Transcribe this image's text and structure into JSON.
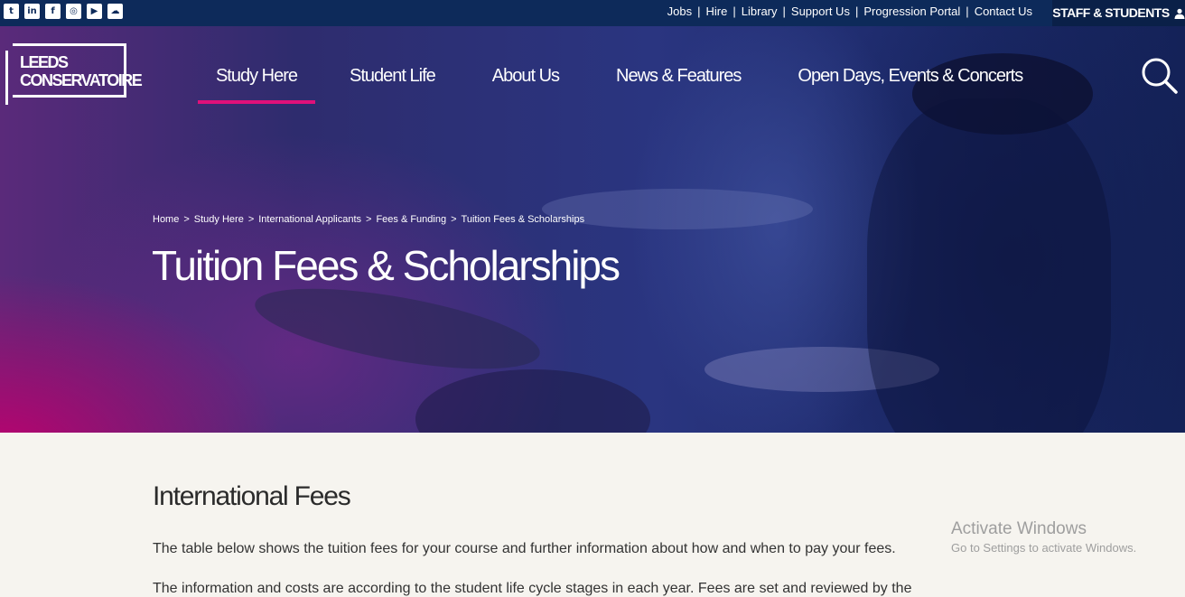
{
  "social": {
    "icons": [
      "twitter-icon",
      "linkedin-icon",
      "facebook-icon",
      "instagram-icon",
      "youtube-icon",
      "soundcloud-icon"
    ]
  },
  "utility_nav": [
    "Jobs",
    "Hire",
    "Library",
    "Support Us",
    "Progression Portal",
    "Contact Us"
  ],
  "separator": "|",
  "staff": {
    "label": "STAFF & STUDENTS"
  },
  "logo": {
    "line1": "LEEDS",
    "line2": "CONSERVATOIRE"
  },
  "main_nav": [
    "Study Here",
    "Student Life",
    "About Us",
    "News & Features",
    "Open Days, Events & Concerts"
  ],
  "breadcrumb": {
    "items": [
      "Home",
      "Study Here",
      "International Applicants",
      "Fees & Funding",
      "Tuition Fees & Scholarships"
    ],
    "separator": ">"
  },
  "hero": {
    "title": "Tuition Fees & Scholarships"
  },
  "content": {
    "heading": "International Fees",
    "paragraph": "The table below shows the tuition fees for your course and further information about how and when to pay your fees.",
    "paragraph2": "The information and costs are according to the student life cycle stages in each year. Fees are set and reviewed by the"
  },
  "watermark": {
    "title": "Activate Windows",
    "subtitle": "Go to Settings to activate Windows."
  },
  "colors": {
    "topbar": "#0d2a5a",
    "accent": "#e0107a",
    "page_bg": "#f6f4ef"
  }
}
